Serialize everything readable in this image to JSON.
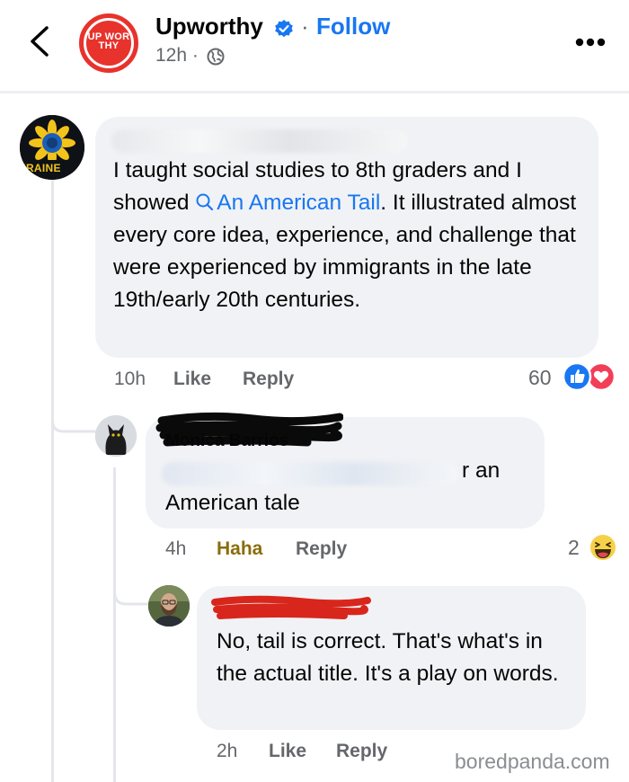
{
  "header": {
    "logo_text": "UP WOR THY",
    "page_name": "Upworthy",
    "separator": "·",
    "follow_label": "Follow",
    "time": "12h ·"
  },
  "comments": [
    {
      "avatar_label": "KRAINE",
      "text_before_link": "I taught social studies to 8th graders and I showed ",
      "link_text": "An American Tail",
      "text_after_link": ". It illustrated almost every core idea, experience, and challenge that were experienced by immigrants in the late 19th/early 20th centuries.",
      "time": "10h",
      "like_label": "Like",
      "reply_label": "Reply",
      "reaction_count": "60"
    },
    {
      "author": "Monica Barrios",
      "text_tail": "r an",
      "text_line2": "American tale",
      "time": "4h",
      "reaction_label": "Haha",
      "reply_label": "Reply",
      "reaction_count": "2"
    },
    {
      "text": "No, tail is correct. That's what's in the actual title. It's a play on words.",
      "time": "2h",
      "like_label": "Like",
      "reply_label": "Reply"
    }
  ],
  "watermark": "boredpanda.com",
  "icons": [
    "chevron-left-icon",
    "verified-badge-icon",
    "globe-icon",
    "more-icon",
    "like-reaction-icon",
    "love-reaction-icon",
    "haha-reaction-icon"
  ],
  "colors": {
    "accent": "#1877f2",
    "brand_red": "#e8322c",
    "haha": "#8a6d0b"
  }
}
